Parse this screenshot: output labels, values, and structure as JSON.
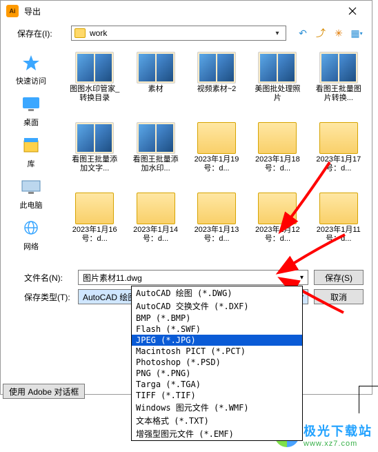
{
  "title": "导出",
  "app_badge": "Ai",
  "save_in_label": "保存在(I):",
  "location": "work",
  "sidebar": [
    {
      "label": "快速访问",
      "icon": "star"
    },
    {
      "label": "桌面",
      "icon": "desktop"
    },
    {
      "label": "库",
      "icon": "library"
    },
    {
      "label": "此电脑",
      "icon": "pc"
    },
    {
      "label": "网络",
      "icon": "network"
    }
  ],
  "files": [
    {
      "name": "图图水印管家_转换目录",
      "type": "photo"
    },
    {
      "name": "素材",
      "type": "photo"
    },
    {
      "name": "视频素材~2",
      "type": "photo"
    },
    {
      "name": "美图批处理照片",
      "type": "photo"
    },
    {
      "name": "看图王批量图片转换...",
      "type": "photo"
    },
    {
      "name": "看图王批量添加文字...",
      "type": "photo"
    },
    {
      "name": "看图王批量添加水印...",
      "type": "photo"
    },
    {
      "name": "2023年1月19号：d...",
      "type": "folder"
    },
    {
      "name": "2023年1月18号：d...",
      "type": "folder"
    },
    {
      "name": "2023年1月17号：d...",
      "type": "folder"
    },
    {
      "name": "2023年1月16号：d...",
      "type": "folder"
    },
    {
      "name": "2023年1月14号：d...",
      "type": "folder"
    },
    {
      "name": "2023年1月13号：d...",
      "type": "folder"
    },
    {
      "name": "2023年1月12号：d...",
      "type": "folder"
    },
    {
      "name": "2023年1月11号：d...",
      "type": "folder"
    }
  ],
  "filename_label": "文件名(N):",
  "filename_value": "图片素材11.dwg",
  "filetype_label": "保存类型(T):",
  "filetype_value": "AutoCAD 绘图 (*.DWG)",
  "save_btn": "保存(S)",
  "cancel_btn": "取消",
  "adobe_btn": "使用 Adobe 对话框",
  "dropdown_options": [
    "AutoCAD 绘图 (*.DWG)",
    "AutoCAD 交换文件 (*.DXF)",
    "BMP (*.BMP)",
    "Flash (*.SWF)",
    "JPEG (*.JPG)",
    "Macintosh PICT (*.PCT)",
    "Photoshop (*.PSD)",
    "PNG (*.PNG)",
    "Targa (*.TGA)",
    "TIFF (*.TIF)",
    "Windows 图元文件 (*.WMF)",
    "文本格式 (*.TXT)",
    "增强型图元文件 (*.EMF)"
  ],
  "dropdown_selected_index": 4,
  "watermark": {
    "cn": "极光下载站",
    "url": "www.xz7.com"
  }
}
